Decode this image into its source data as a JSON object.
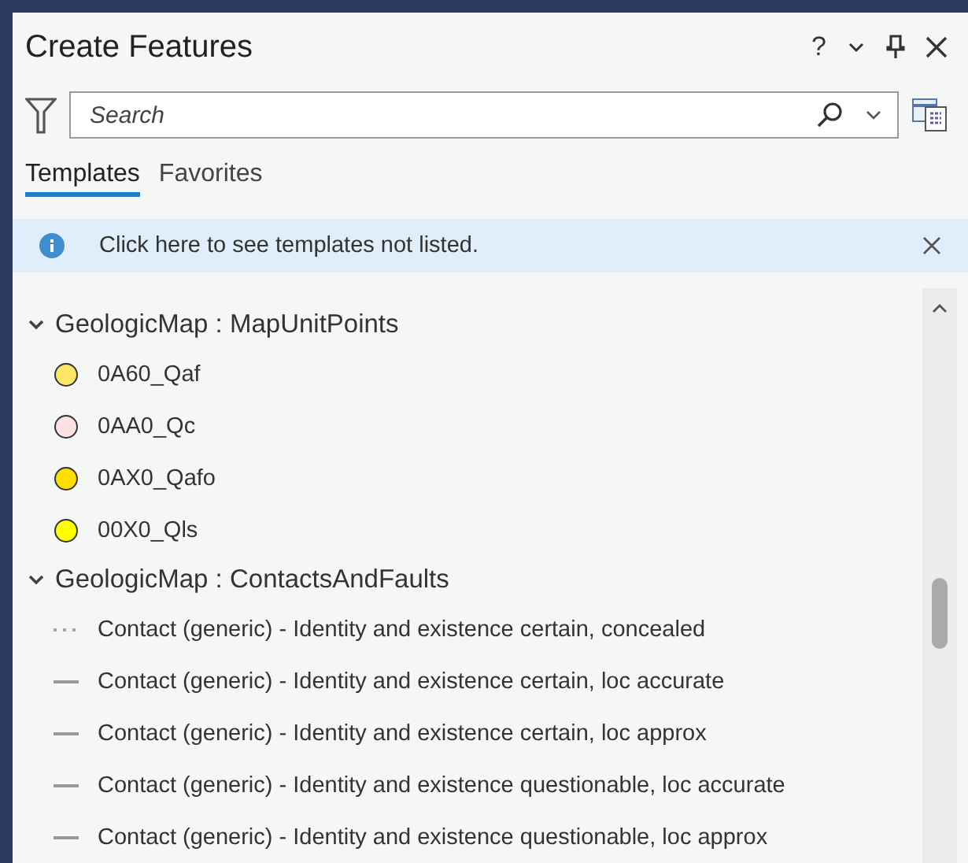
{
  "panel": {
    "title": "Create Features",
    "title_buttons": [
      "?"
    ]
  },
  "search": {
    "placeholder": "Search"
  },
  "tabs": [
    {
      "label": "Templates",
      "selected": true
    },
    {
      "label": "Favorites",
      "selected": false
    }
  ],
  "info_bar": {
    "message": "Click here to see templates not listed."
  },
  "groups": [
    {
      "title": "GeologicMap : MapUnitPoints",
      "expanded": true,
      "items": [
        {
          "kind": "point",
          "label": "0A60_Qaf",
          "color": "#ffe566"
        },
        {
          "kind": "point",
          "label": "0AA0_Qc",
          "color": "#fbe3e3"
        },
        {
          "kind": "point",
          "label": "0AX0_Qafo",
          "color": "#ffdf00"
        },
        {
          "kind": "point",
          "label": "00X0_Qls",
          "color": "#ffff00"
        }
      ]
    },
    {
      "title": "GeologicMap : ContactsAndFaults",
      "expanded": true,
      "items": [
        {
          "kind": "line",
          "label": "Contact (generic) - Identity and existence certain, concealed",
          "dotted": true
        },
        {
          "kind": "line",
          "label": "Contact (generic) - Identity and existence certain, loc accurate",
          "dotted": false
        },
        {
          "kind": "line",
          "label": "Contact (generic) - Identity and existence certain, loc approx",
          "dotted": false
        },
        {
          "kind": "line",
          "label": "Contact (generic) - Identity and existence questionable, loc accurate",
          "dotted": false
        },
        {
          "kind": "line",
          "label": "Contact (generic) - Identity and existence questionable, loc approx",
          "dotted": false
        }
      ]
    }
  ]
}
